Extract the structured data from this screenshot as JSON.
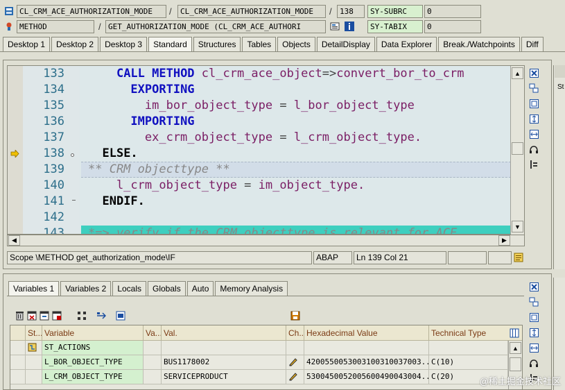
{
  "header": {
    "row1": {
      "field1": "CL_CRM_ACE_AUTHORIZATION_MODE",
      "sep1": "/",
      "field2": "CL_CRM_ACE_AUTHORIZATION_MODE",
      "sep2": "/",
      "line": "138",
      "sysvar": "SY-SUBRC",
      "sysval": "0"
    },
    "row2": {
      "field1": "METHOD",
      "sep1": "/",
      "field2": "GET_AUTHORIZATION_MODE (CL_CRM_ACE_AUTHORI",
      "sysvar": "SY-TABIX",
      "sysval": "0"
    }
  },
  "tabs": [
    "Desktop 1",
    "Desktop 2",
    "Desktop 3",
    "Standard",
    "Structures",
    "Tables",
    "Objects",
    "DetailDisplay",
    "Data Explorer",
    "Break./Watchpoints",
    "Diff"
  ],
  "code_lines": [
    {
      "n": "133",
      "tokens": [
        [
          "    ",
          ""
        ],
        [
          "CALL METHOD",
          "kw"
        ],
        [
          " cl_crm_ace_object",
          "id"
        ],
        [
          "=>",
          "op"
        ],
        [
          "convert_bor_to_crm",
          "id"
        ]
      ]
    },
    {
      "n": "134",
      "tokens": [
        [
          "      ",
          ""
        ],
        [
          "EXPORTING",
          "kw"
        ]
      ]
    },
    {
      "n": "135",
      "tokens": [
        [
          "        im_bor_object_type ",
          "id"
        ],
        [
          "=",
          "op"
        ],
        [
          " l_bor_object_type",
          "id"
        ]
      ]
    },
    {
      "n": "136",
      "tokens": [
        [
          "      ",
          ""
        ],
        [
          "IMPORTING",
          "kw"
        ]
      ]
    },
    {
      "n": "137",
      "tokens": [
        [
          "        ex_crm_object_type ",
          "id"
        ],
        [
          "=",
          "op"
        ],
        [
          " l_crm_object_type.",
          "id"
        ]
      ]
    },
    {
      "n": "138",
      "tokens": [
        [
          "  ",
          ""
        ],
        [
          "ELSE.",
          "kwb"
        ]
      ]
    },
    {
      "n": "139",
      "tokens": [
        [
          "** CRM objecttype **",
          "cm"
        ]
      ]
    },
    {
      "n": "140",
      "tokens": [
        [
          "    l_crm_object_type ",
          "id"
        ],
        [
          "=",
          "op"
        ],
        [
          " im_object_type.",
          "id"
        ]
      ]
    },
    {
      "n": "141",
      "tokens": [
        [
          "  ",
          ""
        ],
        [
          "ENDIF.",
          "kwb"
        ]
      ]
    },
    {
      "n": "142",
      "tokens": []
    },
    {
      "n": "143",
      "tokens": [
        [
          "*=> verify if the CRM objecttype is relevant for ACE",
          "cm"
        ]
      ]
    }
  ],
  "status": {
    "scope": "Scope \\METHOD get_authorization_mode\\IF",
    "lang": "ABAP",
    "pos": "Ln 139 Col  21"
  },
  "var_tabs": [
    "Variables 1",
    "Variables 2",
    "Locals",
    "Globals",
    "Auto",
    "Memory Analysis"
  ],
  "table": {
    "headers": [
      "St...",
      "Variable",
      "Va...",
      "Val.",
      "Ch...",
      "Hexadecimal Value",
      "Technical Type"
    ],
    "rows": [
      {
        "variable": "ST_ACTIONS",
        "val": "",
        "hex": "",
        "type": ""
      },
      {
        "variable": "L_BOR_OBJECT_TYPE",
        "val": "BUS1178002",
        "hex": "4200550053003100310037003...",
        "type": "C(10)"
      },
      {
        "variable": "L_CRM_OBJECT_TYPE",
        "val": "SERVICEPRODUCT",
        "hex": "5300450052005600490043004...",
        "type": "C(20)"
      }
    ]
  },
  "right_panel": {
    "label": "St"
  },
  "watermark": "@稀土掘金技术社区"
}
